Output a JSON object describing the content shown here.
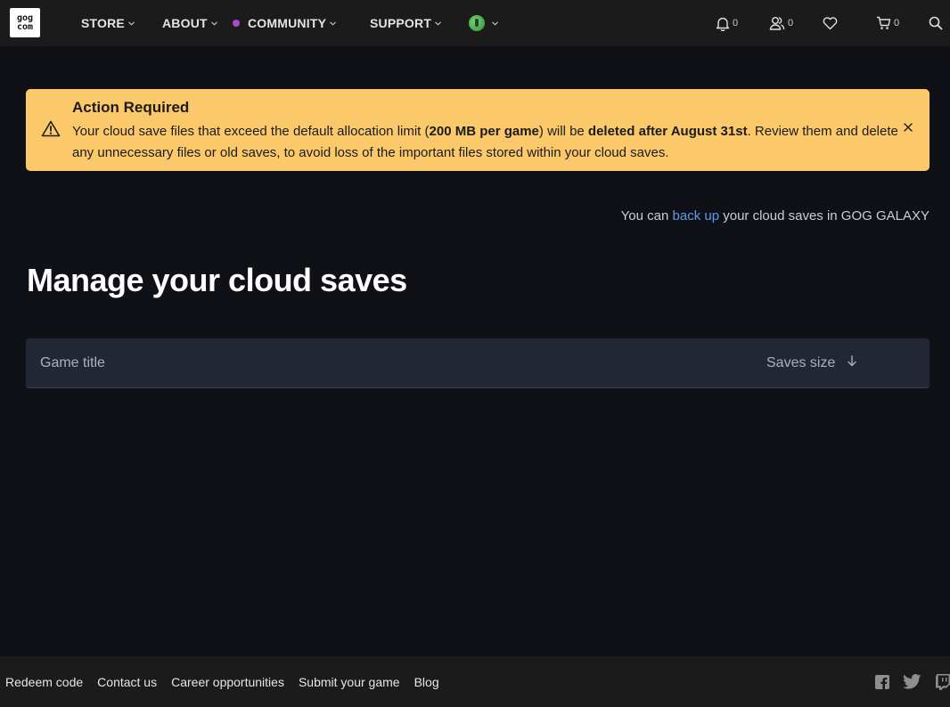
{
  "navbar": {
    "logo_top": "gog",
    "logo_bottom": "com",
    "menu": [
      {
        "label": "STORE"
      },
      {
        "label": "ABOUT"
      },
      {
        "label": "COMMUNITY"
      },
      {
        "label": "SUPPORT"
      }
    ],
    "notifications_count": "0",
    "friends_count": "0",
    "cart_count": "0",
    "icons": [
      "bell-icon",
      "friends-icon",
      "heart-icon",
      "cart-icon",
      "search-icon"
    ],
    "community_dot_color": "#a94bd0"
  },
  "alert": {
    "title": "Action Required",
    "text_1": "Your cloud save files that exceed the default allocation limit (",
    "bold_1": "200 MB per game",
    "text_2": ") will be ",
    "bold_2": "deleted after August 31st",
    "text_3": ". Review them and delete any unnecessary files or old saves, to avoid loss of the important files stored within your cloud saves.",
    "background": "#fcc96a"
  },
  "backup": {
    "prefix": "You can ",
    "link": "back up",
    "suffix": " your cloud saves in GOG GALAXY",
    "link_color": "#5c9bf2"
  },
  "page_title": "Manage your cloud saves",
  "table": {
    "col_title": "Game title",
    "col_size": "Saves size"
  },
  "footer": {
    "links": [
      "Redeem code",
      "Contact us",
      "Career opportunities",
      "Submit your game",
      "Blog"
    ],
    "social_icons": [
      "facebook-icon",
      "twitter-icon",
      "twitch-icon"
    ]
  }
}
